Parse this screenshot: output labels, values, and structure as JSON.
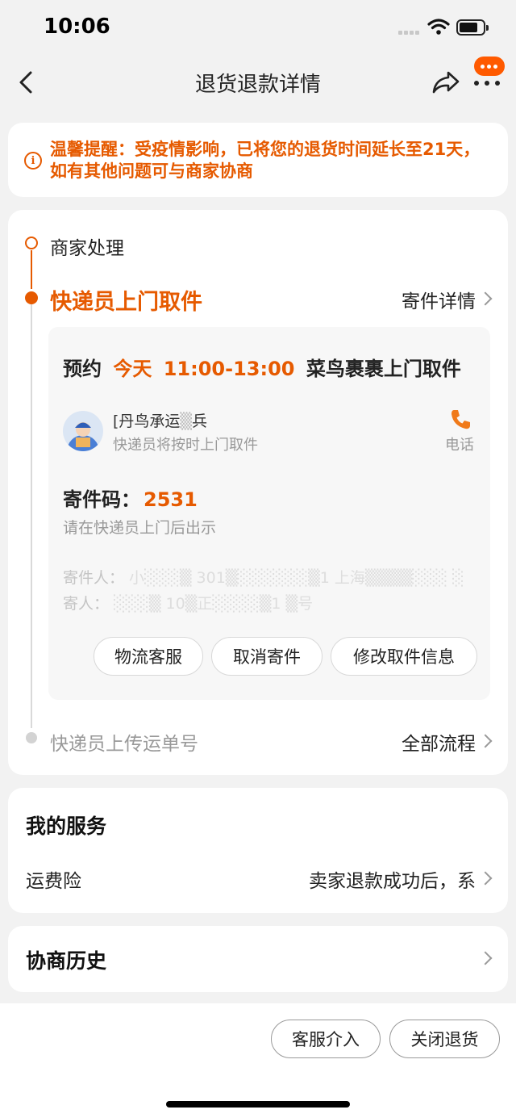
{
  "status_bar": {
    "time": "10:06"
  },
  "nav": {
    "title": "退货退款详情",
    "more_badge_color": "#ff5a00"
  },
  "notice": {
    "icon": "info-icon",
    "text": "温馨提醒：受疫情影响，已将您的退货时间延长至21天，如有其他问题可与商家协商"
  },
  "progress": {
    "steps": [
      {
        "label": "商家处理",
        "state": "done"
      },
      {
        "label": "快递员上门取件",
        "state": "current",
        "link": "寄件详情"
      },
      {
        "label": "快递员上传运单号",
        "state": "pending",
        "link": "全部流程"
      }
    ],
    "pickup": {
      "appointment_prefix": "预约",
      "appointment_day": "今天",
      "appointment_time": "11:00-13:00",
      "appointment_service": "菜鸟裹裹上门取件",
      "courier_name": "[丹鸟承运",
      "courier_name_tail": "兵",
      "courier_note": "快递员将按时上门取件",
      "phone_label": "电话",
      "code_label": "寄件码：",
      "code_value": "2531",
      "code_hint": "请在快递员上门后出示",
      "sender_label": "寄件人：",
      "receiver_label": "寄人：",
      "buttons": [
        "物流客服",
        "取消寄件",
        "修改取件信息"
      ]
    }
  },
  "services": {
    "title": "我的服务",
    "item_label": "运费险",
    "item_value": "卖家退款成功后，系"
  },
  "history": {
    "title": "协商历史"
  },
  "bottom": {
    "buttons": [
      "客服介入",
      "关闭退货"
    ]
  },
  "colors": {
    "accent": "#e65a00",
    "background": "#f2f2f2"
  }
}
